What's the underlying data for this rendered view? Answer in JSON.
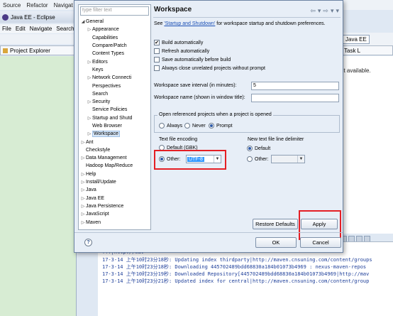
{
  "bg": {
    "menubar": [
      "Source",
      "Refactor",
      "Navigat"
    ],
    "title": "Java EE - Eclipse",
    "menu2": [
      "File",
      "Edit",
      "Navigate",
      "Search"
    ],
    "left_tab": "Project Explorer",
    "perspective": "Java EE",
    "right_tab": "Task L",
    "not_available": "ot available.",
    "console_lines": [
      "",
      "                                                  fff|http://mav",
      "17-3-14 上午10时23分18秒: Updating index thirdparty|http://maven.cnsuning.com/content/groups",
      "17-3-14 上午10时23分18秒: Downloading 445702489bdd68830a184b01073b4969 : nexus-maven-repos",
      "17-3-14 上午10时23分19秒: Downloaded Repository[445702489bdd68830a184b01073b4969|http://mav",
      "17-3-14 上午10时23分21秒: Updated index for central|http://maven.cnsuning.com/content/group"
    ]
  },
  "tree": {
    "filter_placeholder": "type filter text",
    "items": [
      {
        "label": "General",
        "arrow": "◢",
        "indent": 0
      },
      {
        "label": "Appearance",
        "arrow": "▷",
        "indent": 1
      },
      {
        "label": "Capabilities",
        "arrow": "",
        "indent": 1
      },
      {
        "label": "Compare/Patch",
        "arrow": "",
        "indent": 1
      },
      {
        "label": "Content Types",
        "arrow": "",
        "indent": 1
      },
      {
        "label": "Editors",
        "arrow": "▷",
        "indent": 1
      },
      {
        "label": "Keys",
        "arrow": "",
        "indent": 1
      },
      {
        "label": "Network Connecti",
        "arrow": "▷",
        "indent": 1
      },
      {
        "label": "Perspectives",
        "arrow": "",
        "indent": 1
      },
      {
        "label": "Search",
        "arrow": "",
        "indent": 1
      },
      {
        "label": "Security",
        "arrow": "▷",
        "indent": 1
      },
      {
        "label": "Service Policies",
        "arrow": "",
        "indent": 1
      },
      {
        "label": "Startup and Shutd",
        "arrow": "▷",
        "indent": 1
      },
      {
        "label": "Web Browser",
        "arrow": "",
        "indent": 1
      },
      {
        "label": "Workspace",
        "arrow": "▷",
        "indent": 1,
        "selected": true
      },
      {
        "label": "Ant",
        "arrow": "▷",
        "indent": 0
      },
      {
        "label": "Checkstyle",
        "arrow": "",
        "indent": 0
      },
      {
        "label": "Data Management",
        "arrow": "▷",
        "indent": 0
      },
      {
        "label": "Hadoop Map/Reduce",
        "arrow": "",
        "indent": 0
      },
      {
        "label": "Help",
        "arrow": "▷",
        "indent": 0
      },
      {
        "label": "Install/Update",
        "arrow": "▷",
        "indent": 0
      },
      {
        "label": "Java",
        "arrow": "▷",
        "indent": 0
      },
      {
        "label": "Java EE",
        "arrow": "▷",
        "indent": 0
      },
      {
        "label": "Java Persistence",
        "arrow": "▷",
        "indent": 0
      },
      {
        "label": "JavaScript",
        "arrow": "▷",
        "indent": 0
      },
      {
        "label": "Maven",
        "arrow": "▷",
        "indent": 0
      }
    ]
  },
  "page": {
    "title": "Workspace",
    "intro_pre": "See ",
    "intro_link": "'Startup and Shutdown'",
    "intro_post": " for workspace startup and shutdown preferences.",
    "build_auto": "Build automatically",
    "refresh_auto": "Refresh automatically",
    "save_auto": "Save automatically before build",
    "always_close": "Always close unrelated projects without prompt",
    "save_interval_label": "Workspace save interval (in minutes):",
    "save_interval_value": "5",
    "ws_name_label": "Workspace name (shown in window title):",
    "ws_name_value": "",
    "open_ref_label": "Open referenced projects when a project is opened",
    "open_ref_opts": [
      "Always",
      "Never",
      "Prompt"
    ],
    "encoding_label": "Text file encoding",
    "enc_default": "Default (GBK)",
    "enc_other": "Other:",
    "enc_value": "UTF-8",
    "delim_label": "New text file line delimiter",
    "delim_default": "Default",
    "delim_other": "Other:",
    "restore_defaults": "Restore Defaults",
    "apply": "Apply"
  },
  "buttons": {
    "ok": "OK",
    "cancel": "Cancel",
    "help": "?"
  },
  "colors": {
    "annotation": "#e41f25",
    "selection": "#3399ff"
  }
}
